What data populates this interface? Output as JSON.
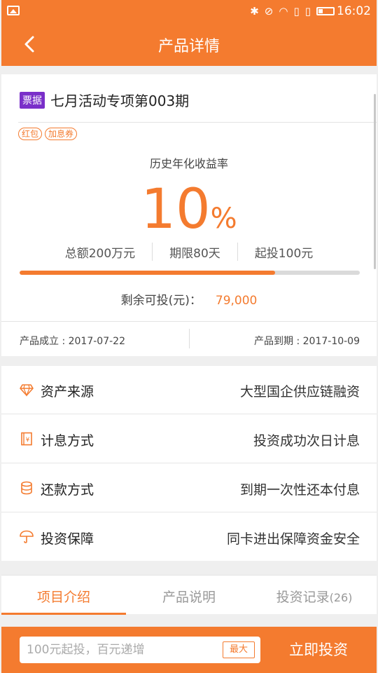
{
  "status_bar": {
    "time": "16:02"
  },
  "header": {
    "title": "产品详情"
  },
  "product": {
    "tag": "票据",
    "name": "七月活动专项第003期",
    "coupons": [
      "红包",
      "加息券"
    ],
    "rate_label": "历史年化收益率",
    "rate_value": "10",
    "rate_unit": "%",
    "total": "总额200万元",
    "term": "期限80天",
    "min_invest": "起投100元",
    "progress_fraction": 0.75,
    "remaining_label": "剩余可投(元)：",
    "remaining_value": "79,000"
  },
  "dates": {
    "start": "产品成立 : 2017-07-22",
    "end": "产品到期 : 2017-10-09"
  },
  "info_rows": [
    {
      "icon": "diamond-icon",
      "label": "资产来源",
      "value": "大型国企供应链融资"
    },
    {
      "icon": "ledger-icon",
      "label": "计息方式",
      "value": "投资成功次日计息"
    },
    {
      "icon": "coins-icon",
      "label": "还款方式",
      "value": "到期一次性还本付息"
    },
    {
      "icon": "umbrella-icon",
      "label": "投资保障",
      "value": "同卡进出保障资金安全"
    }
  ],
  "tabs": [
    {
      "label": "项目介绍",
      "active": true
    },
    {
      "label": "产品说明",
      "active": false
    },
    {
      "label": "投资记录",
      "count": "(26)",
      "active": false
    }
  ],
  "bottom": {
    "placeholder": "100元起投，百元递增",
    "max_label": "最大",
    "invest_label": "立即投资"
  },
  "colors": {
    "accent": "#f47b2f",
    "tag_bg": "#7a2fc9"
  }
}
